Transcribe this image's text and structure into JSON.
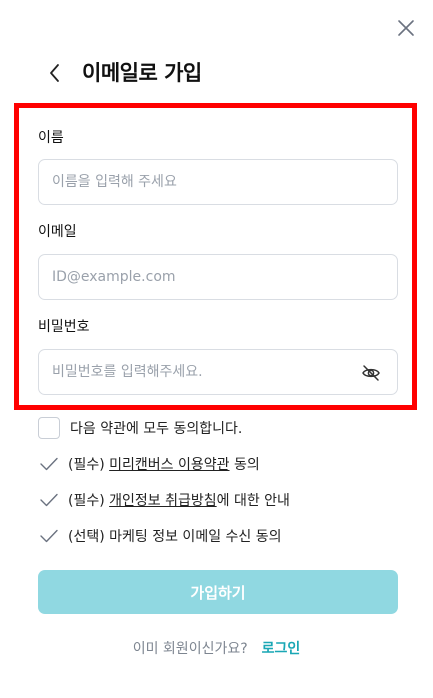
{
  "header": {
    "title": "이메일로 가입",
    "close_icon": "close-icon",
    "back_icon": "chevron-left-icon"
  },
  "form": {
    "name": {
      "label": "이름",
      "placeholder": "이름을 입력해 주세요"
    },
    "email": {
      "label": "이메일",
      "placeholder": "ID@example.com"
    },
    "password": {
      "label": "비밀번호",
      "placeholder": "비밀번호를 입력해주세요.",
      "toggle_icon": "eye-off-icon"
    }
  },
  "terms": {
    "agree_all": "다음 약관에 모두 동의합니다.",
    "items": [
      {
        "prefix": "(필수) ",
        "link": "미리캔버스 이용약관",
        "suffix": " 동의"
      },
      {
        "prefix": "(필수) ",
        "link": "개인정보 취급방침",
        "suffix": "에 대한 안내"
      },
      {
        "prefix": "(선택) 마케팅 정보 이메일 수신 동의",
        "link": "",
        "suffix": ""
      }
    ]
  },
  "actions": {
    "signup_label": "가입하기"
  },
  "footer": {
    "question": "이미 회원이신가요?",
    "login_label": "로그인"
  },
  "colors": {
    "highlight_border": "#ff0000",
    "primary_button": "#90d8e1",
    "link_accent": "#1aa7b5"
  }
}
